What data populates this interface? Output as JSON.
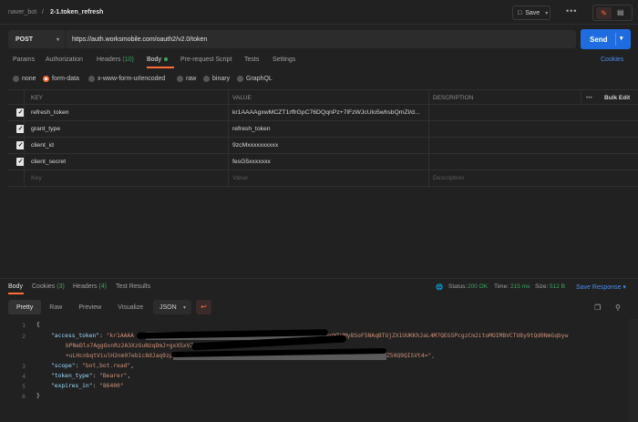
{
  "header": {
    "workspace": "naver_bot",
    "separator": "/",
    "request_name": "2-1.token_refresh",
    "save_label": "Save",
    "more": "•••"
  },
  "request": {
    "method": "POST",
    "url": "https://auth.worksmobile.com/oauth2/v2.0/token",
    "send_label": "Send"
  },
  "tabs": {
    "params": "Params",
    "authorization": "Authorization",
    "headers": "Headers",
    "headers_count": "(10)",
    "body": "Body",
    "pre_request": "Pre-request Script",
    "tests": "Tests",
    "settings": "Settings",
    "cookies": "Cookies"
  },
  "body_types": [
    "none",
    "form-data",
    "x-www-form-urlencoded",
    "raw",
    "binary",
    "GraphQL"
  ],
  "table": {
    "col_key": "KEY",
    "col_value": "VALUE",
    "col_description": "DESCRIPTION",
    "bulk_edit": "Bulk Edit",
    "more": "•••",
    "rows": [
      {
        "key": "refresh_token",
        "value": "kr1AAAAgxwMCZT1rffrGpC76DQqnPz+7lFzWJcUlo5whsbQmZl/d..."
      },
      {
        "key": "grant_type",
        "value": "refresh_token"
      },
      {
        "key": "client_id",
        "value": "9zcMxxxxxxxxxx"
      },
      {
        "key": "client_secret",
        "value": "fesG5xxxxxxx"
      }
    ],
    "placeholder": {
      "key": "Key",
      "value": "Value",
      "description": "Description"
    }
  },
  "response": {
    "tabs": {
      "body": "Body",
      "cookies": "Cookies",
      "cookies_count": "(3)",
      "headers": "Headers",
      "headers_count": "(4)",
      "test_results": "Test Results"
    },
    "status_label": "Status:",
    "status_value": "200 OK",
    "time_label": "Time:",
    "time_value": "215 ms",
    "size_label": "Size:",
    "size_value": "512 B",
    "save_response": "Save Response",
    "views": [
      "Pretty",
      "Raw",
      "Preview",
      "Visualize"
    ],
    "format": "JSON",
    "code_lines": [
      {
        "n": "1",
        "text": "{"
      },
      {
        "n": "2",
        "key": "\"access_token\"",
        "value": "\"kr1AAAA"
      },
      {
        "n": "",
        "value": "bPNeDlx7AggOxnRz2A3XzGuNzqDmJ+gxXSxVZxA2fuxme5mh/4"
      },
      {
        "n": "",
        "value": "+uLHcnbqtViulH2nm97eb1c8dJaq9zpU"
      },
      {
        "n": "3",
        "key": "\"scope\"",
        "value": "\"bot,bot.read\""
      },
      {
        "n": "4",
        "key": "\"token_type\"",
        "value": "\"Bearer\""
      },
      {
        "n": "5",
        "key": "\"expires_in\"",
        "value": "\"86400\""
      },
      {
        "n": "6",
        "text": "}"
      }
    ],
    "line2_tail": "bqWlUMy8SoF5NAqBTUjZX1UUKKhJaL4M7QEGSPcgzCm2itoMOIMBVCTU8y9tQd0NmGqbyw",
    "line4_tail": "Z50Q9QISVt4=\","
  }
}
